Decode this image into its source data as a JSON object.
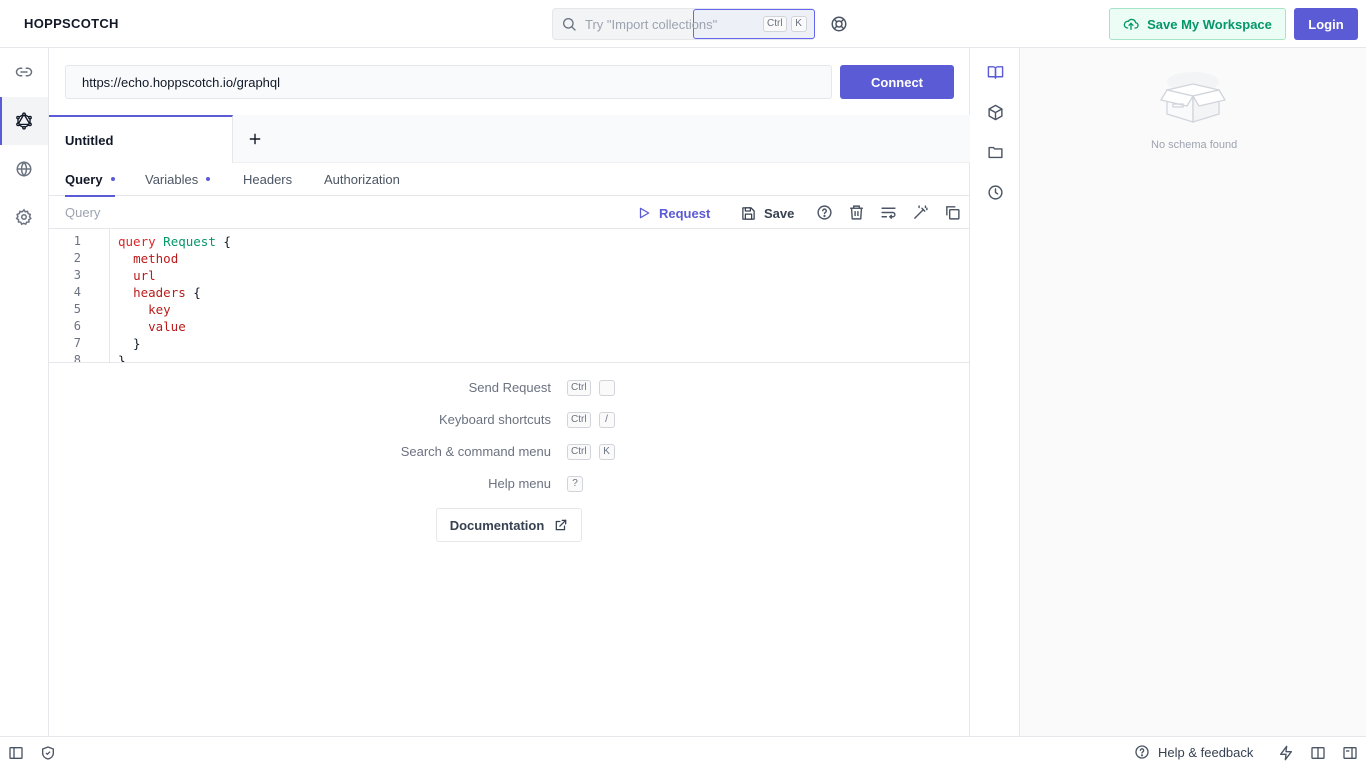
{
  "app": {
    "brand": "HOPPSCOTCH"
  },
  "header": {
    "search_placeholder": "Try \"Import collections\"",
    "search_keys": [
      "Ctrl",
      "K"
    ],
    "save_workspace": "Save My Workspace",
    "login": "Login"
  },
  "connection": {
    "url": "https://echo.hoppscotch.io/graphql",
    "connect_label": "Connect"
  },
  "tabs": {
    "items": [
      {
        "label": "Untitled"
      }
    ],
    "add_icon": "plus-icon"
  },
  "subtabs": [
    {
      "label": "Query",
      "active": true,
      "dot": true
    },
    {
      "label": "Variables",
      "active": false,
      "dot": true
    },
    {
      "label": "Headers",
      "active": false,
      "dot": false
    },
    {
      "label": "Authorization",
      "active": false,
      "dot": false
    }
  ],
  "toolbar": {
    "label": "Query",
    "request_label": "Request",
    "save_label": "Save"
  },
  "editor": {
    "line_numbers": [
      "1",
      "2",
      "3",
      "4",
      "5",
      "6",
      "7",
      "8"
    ],
    "lines": [
      "query Request {",
      "  method",
      "  url",
      "  headers {",
      "    key",
      "    value",
      "  }",
      "}"
    ]
  },
  "shortcuts": [
    {
      "label": "Send Request",
      "keys": [
        "Ctrl",
        ""
      ]
    },
    {
      "label": "Keyboard shortcuts",
      "keys": [
        "Ctrl",
        "/"
      ]
    },
    {
      "label": "Search & command menu",
      "keys": [
        "Ctrl",
        "K"
      ]
    },
    {
      "label": "Help menu",
      "keys": [
        "?"
      ]
    }
  ],
  "documentation_label": "Documentation",
  "schema": {
    "empty_text": "No schema found"
  },
  "footer": {
    "help_feedback": "Help & feedback"
  },
  "colors": {
    "accent": "#5b5bd6",
    "success": "#059669",
    "keyword": "#dc2626",
    "type": "#059669"
  }
}
